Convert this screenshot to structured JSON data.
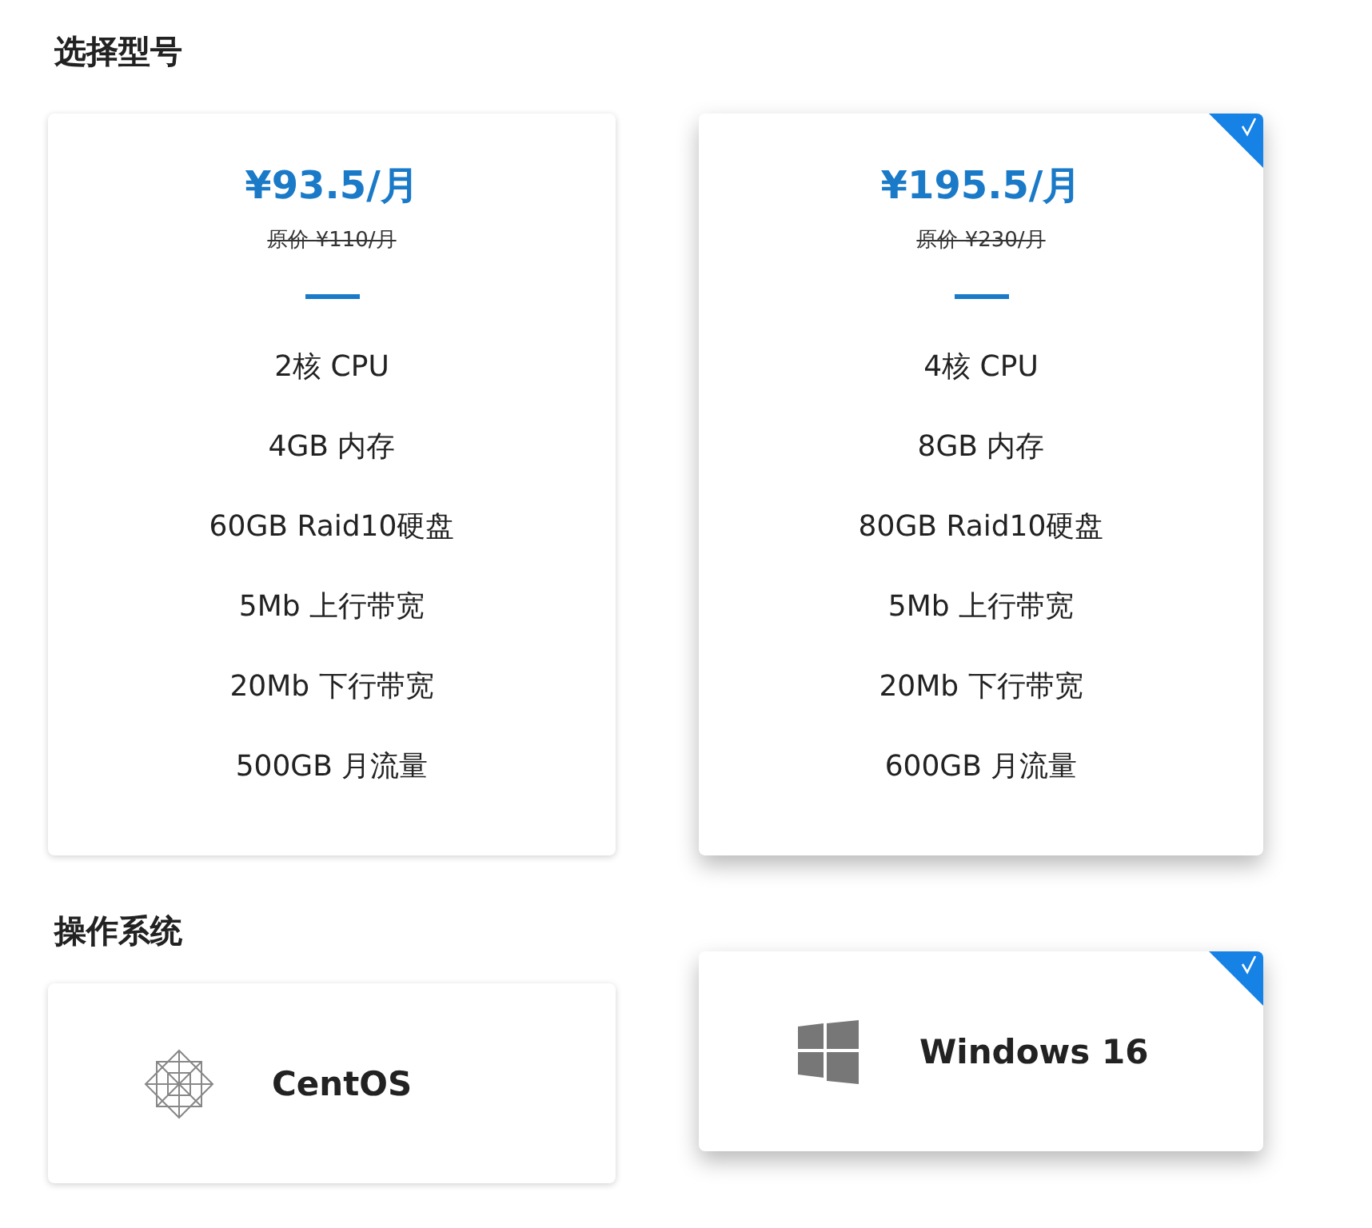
{
  "model_section": {
    "title": "选择型号",
    "plans": [
      {
        "price": "¥93.5/月",
        "original_price": "原价 ¥110/月",
        "selected": false,
        "specs": [
          "2核 CPU",
          "4GB 内存",
          "60GB Raid10硬盘",
          "5Mb 上行带宽",
          "20Mb 下行带宽",
          "500GB 月流量"
        ]
      },
      {
        "price": "¥195.5/月",
        "original_price": "原价 ¥230/月",
        "selected": true,
        "specs": [
          "4核 CPU",
          "8GB 内存",
          "80GB Raid10硬盘",
          "5Mb 上行带宽",
          "20Mb 下行带宽",
          "600GB 月流量"
        ]
      }
    ]
  },
  "os_section": {
    "title": "操作系统",
    "options": [
      {
        "kind": "centos",
        "name": "CentOS",
        "selected": false
      },
      {
        "kind": "windows",
        "name": "Windows 16",
        "selected": true
      }
    ]
  }
}
